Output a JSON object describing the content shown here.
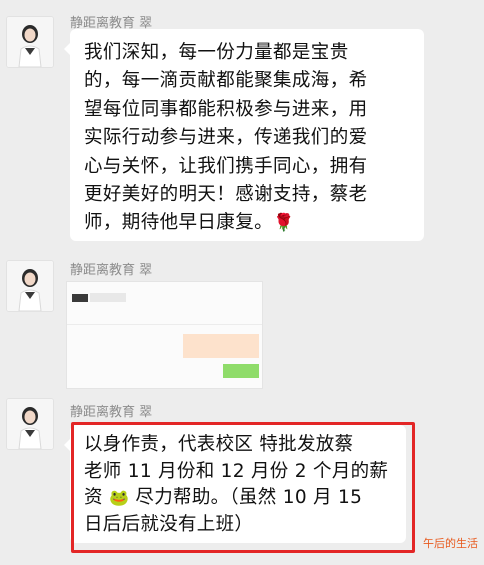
{
  "colors": {
    "background": "#ededed",
    "bubble": "#ffffff",
    "sender_text": "#8c8c8c",
    "highlight_border": "#e32626",
    "watermark": "#e85a1e"
  },
  "messages": [
    {
      "sender": "静距离教育 翠",
      "avatar": "avatar-icon",
      "lines": [
        "我们深知，每一份力量都是宝贵",
        "的，每一滴贡献都能聚集成海，希",
        "望每位同事都能积极参与进来，用",
        "实际行动参与进来，传递我们的爱",
        "心与关怀，让我们携手同心，拥有",
        "更好美好的明天！感谢支持，蔡老",
        "师，期待他早日康复。"
      ],
      "emoji": "🌹"
    },
    {
      "sender": "静距离教育 翠",
      "avatar": "avatar-icon",
      "image": "screenshot-image"
    },
    {
      "sender": "静距离教育 翠",
      "avatar": "avatar-icon",
      "lines": [
        "以身作责，代表校区 特批发放蔡",
        "老师 11 月份和 12 月份 2 个月的薪",
        "资",
        "尽力帮助。（虽然 10 月 15",
        "日后后就没有上班）"
      ],
      "emoji": "🐸"
    }
  ],
  "watermark": "午后的生活"
}
